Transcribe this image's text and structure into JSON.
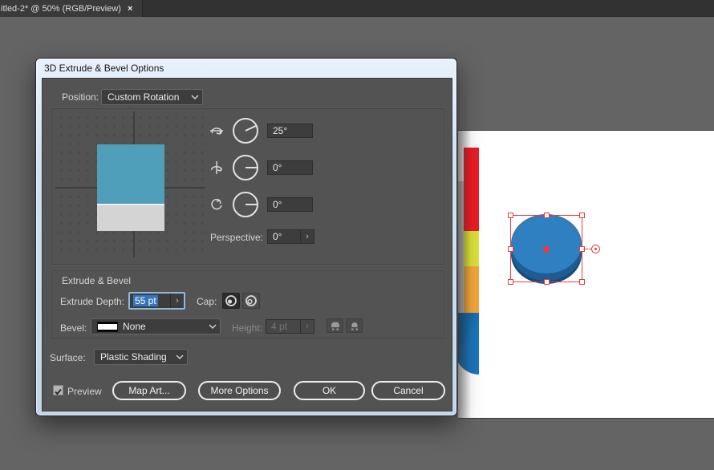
{
  "window": {
    "tab_title": "itled-2* @ 50% (RGB/Preview)",
    "tab_close": "×"
  },
  "dialog": {
    "title": "3D Extrude & Bevel Options",
    "position_label": "Position:",
    "position_value": "Custom Rotation",
    "rotation": {
      "x_value": "25°",
      "x_deg": 25,
      "y_value": "0°",
      "y_deg": 0,
      "z_value": "0°",
      "z_deg": 0
    },
    "perspective_label": "Perspective:",
    "perspective_value": "0°",
    "extrude_section": {
      "header": "Extrude & Bevel",
      "depth_label": "Extrude Depth:",
      "depth_value": "55 pt",
      "cap_label": "Cap:",
      "bevel_label": "Bevel:",
      "bevel_value": "None",
      "height_label": "Height:",
      "height_value": "4 pt"
    },
    "surface_label": "Surface:",
    "surface_value": "Plastic Shading",
    "preview_label": "Preview",
    "buttons": {
      "map_art": "Map Art...",
      "more_options": "More Options",
      "ok": "OK",
      "cancel": "Cancel"
    },
    "glyphs": {
      "stepper_arrow": "›"
    }
  },
  "artboard": {
    "strip": {
      "side_color": "#c9c9c9",
      "segments": [
        {
          "name": "red",
          "color": "#ec1c24"
        },
        {
          "name": "yellow",
          "color": "#dde23b"
        },
        {
          "name": "orange",
          "color": "#f3a73a"
        },
        {
          "name": "blue",
          "color": "#1b75bc"
        }
      ]
    },
    "disk": {
      "top_color": "#2e80c1",
      "side_color": "#1e5d92"
    },
    "selection_color": "#ee3a3c",
    "background": "#ffffff"
  },
  "colors": {
    "app_canvas": "#646464",
    "dialog_body": "#535353",
    "text_selection": "#3476bd",
    "cube_face": "#4f9eba",
    "cube_side": "#d4d4d4"
  }
}
